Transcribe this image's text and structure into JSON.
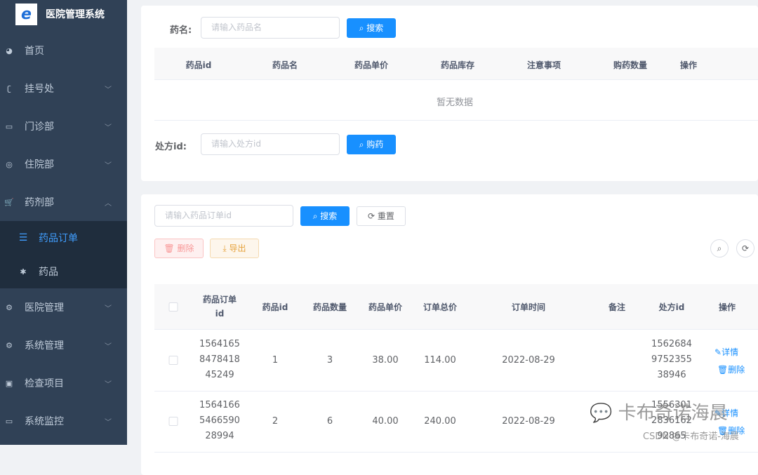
{
  "sidebar": {
    "title": "医院管理系统",
    "logo_letter": "e",
    "items": [
      {
        "label": "首页",
        "icon": "dashboard-icon"
      },
      {
        "label": "挂号处",
        "icon": "register-icon"
      },
      {
        "label": "门诊部",
        "icon": "monitor-icon"
      },
      {
        "label": "住院部",
        "icon": "lifebuoy-icon"
      },
      {
        "label": "药剂部",
        "icon": "cart-icon"
      },
      {
        "label": "药品订单",
        "icon": "list-icon"
      },
      {
        "label": "药品",
        "icon": "bug-icon"
      },
      {
        "label": "医院管理",
        "icon": "gear-icon"
      },
      {
        "label": "系统管理",
        "icon": "gear-icon"
      },
      {
        "label": "检查项目",
        "icon": "briefcase-icon"
      },
      {
        "label": "系统监控",
        "icon": "monitor-icon"
      }
    ]
  },
  "search_card": {
    "drug_name_label": "药名:",
    "drug_name_placeholder": "请输入药品名",
    "search_btn": "搜索",
    "columns": [
      "药品id",
      "药品名",
      "药品单价",
      "药品库存",
      "注意事项",
      "购药数量",
      "操作"
    ],
    "empty": "暂无数据",
    "prescription_label": "处方id:",
    "prescription_placeholder": "请输入处方id",
    "buy_btn": "购药"
  },
  "orders": {
    "search_placeholder": "请输入药品订单id",
    "search_btn": "搜索",
    "reset_btn": "重置",
    "delete_btn": "删除",
    "export_btn": "导出",
    "columns": [
      "药品订单id",
      "药品id",
      "药品数量",
      "药品单价",
      "订单总价",
      "订单时间",
      "备注",
      "处方id",
      "操作"
    ],
    "rows": [
      {
        "order_id": [
          "1564165",
          "8478418",
          "45249"
        ],
        "drug_id": "1",
        "qty": "3",
        "price": "38.00",
        "total": "114.00",
        "time": "2022-08-29",
        "note": "",
        "rx_id": [
          "1562684",
          "9752355",
          "38946"
        ]
      },
      {
        "order_id": [
          "1564166",
          "5466590",
          "28994"
        ],
        "drug_id": "2",
        "qty": "6",
        "price": "40.00",
        "total": "240.00",
        "time": "2022-08-29",
        "note": "",
        "rx_id": [
          "1556301",
          "2836162",
          "92865"
        ]
      }
    ],
    "detail_link": "详情",
    "delete_link": "删除"
  },
  "watermark": {
    "main": "卡布奇诺海晨",
    "sub": "CSDN @卡布奇诺-海晨"
  }
}
